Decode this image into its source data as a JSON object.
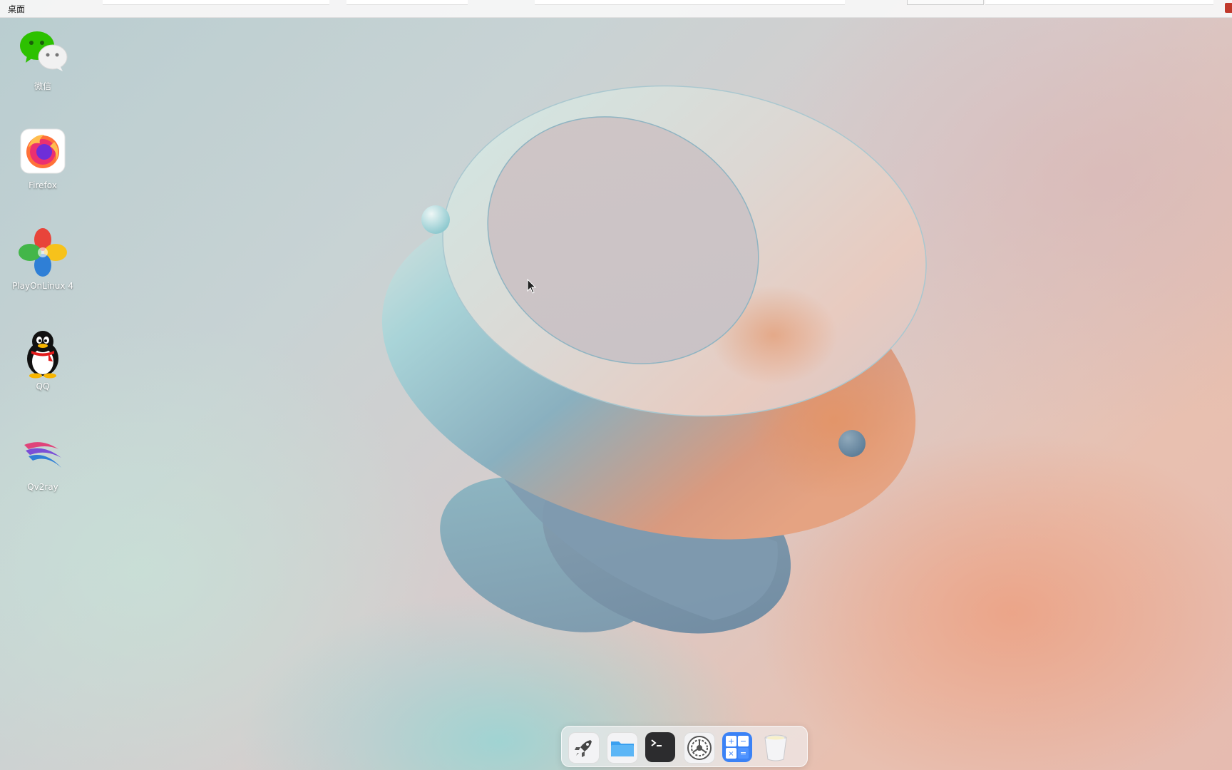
{
  "top_panel": {
    "title": "桌面"
  },
  "desktop_icons": [
    {
      "label": "微信",
      "icon": "wechat-icon"
    },
    {
      "label": "Firefox",
      "icon": "firefox-icon"
    },
    {
      "label": "PlayOnLinux 4",
      "icon": "playonlinux-icon"
    },
    {
      "label": "QQ",
      "icon": "qq-penguin-icon"
    },
    {
      "label": "Qv2ray",
      "icon": "qv2ray-icon"
    }
  ],
  "dock": {
    "items": [
      {
        "icon": "launcher-rocket-icon"
      },
      {
        "icon": "file-manager-folder-icon"
      },
      {
        "icon": "terminal-icon"
      },
      {
        "icon": "system-settings-gear-icon"
      },
      {
        "icon": "calculator-icon"
      },
      {
        "icon": "trash-icon"
      }
    ]
  },
  "colors": {
    "dock_background": "#f0f0f2",
    "panel_background": "#f6f6f6",
    "wechat_green": "#2dc100",
    "calculator_blue": "#3b82f6"
  }
}
